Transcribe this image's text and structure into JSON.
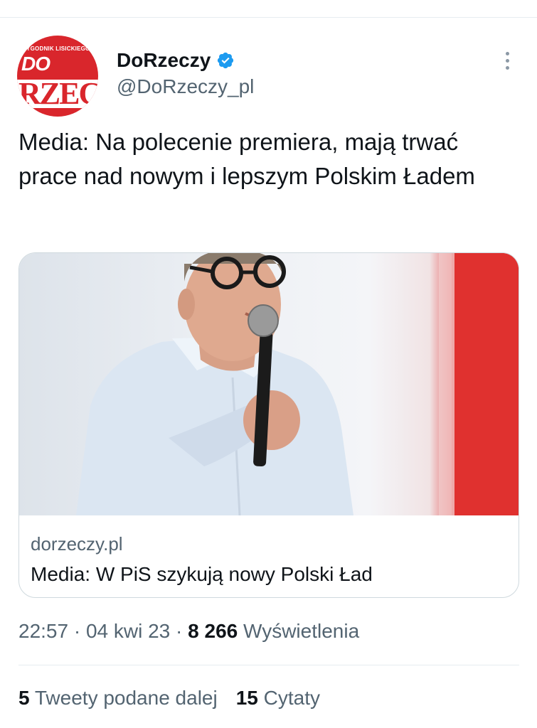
{
  "author": {
    "display_name": "DoRzeczy",
    "handle": "@DoRzeczy_pl",
    "avatar_logo": {
      "tagline": "TYGODNIK LISICKIEGO",
      "top": "DO",
      "bottom": "RZEC"
    },
    "verified_icon": "verified-badge-icon",
    "colors": {
      "brand_red": "#d9262c",
      "verified_blue": "#1d9bf0"
    }
  },
  "more_icon": "more-options-icon",
  "tweet": {
    "text": "Media: Na polecenie premiera, mają trwać prace nad nowym i lepszym Polskim Ładem"
  },
  "card": {
    "domain": "dorzeczy.pl",
    "title": "Media: W PiS szykują nowy Polski Ład"
  },
  "meta": {
    "time": "22:57",
    "separator": "·",
    "date": "04 kwi 23",
    "views_count": "8 266",
    "views_label": "Wyświetlenia"
  },
  "stats": {
    "retweets_count": "5",
    "retweets_label": "Tweety podane dalej",
    "quotes_count": "15",
    "quotes_label": "Cytaty"
  }
}
